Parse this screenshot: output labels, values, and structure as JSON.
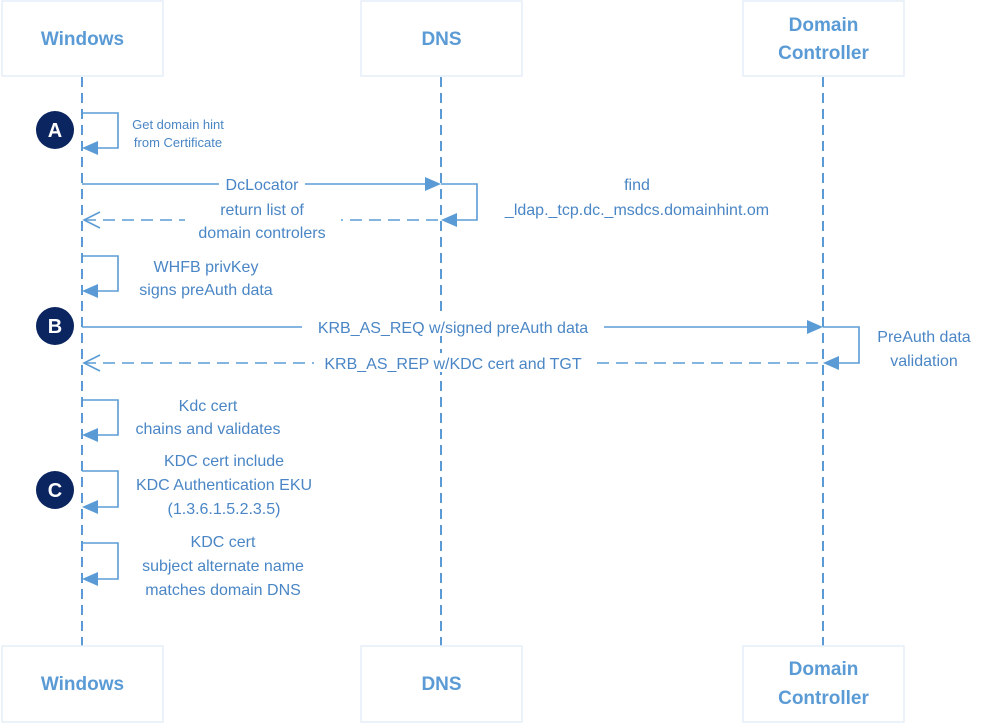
{
  "actors": [
    {
      "id": "windows",
      "label_lines": [
        "Windows"
      ]
    },
    {
      "id": "dns",
      "label_lines": [
        "DNS"
      ]
    },
    {
      "id": "dc",
      "label_lines": [
        "Domain",
        "Controller"
      ]
    }
  ],
  "badges": [
    "A",
    "B",
    "C"
  ],
  "messages": {
    "get_domain_hint": {
      "from": "windows",
      "to": "windows",
      "type": "self",
      "lines": [
        "Get domain hint",
        "from Certificate"
      ]
    },
    "dclocator": {
      "from": "windows",
      "to": "dns",
      "type": "solid",
      "lines": [
        "DcLocator"
      ]
    },
    "find_ldap": {
      "from": "dns",
      "to": "dns",
      "type": "self",
      "lines": [
        "find",
        "_ldap._tcp.dc._msdcs.domainhint.om"
      ]
    },
    "return_list": {
      "from": "dns",
      "to": "windows",
      "type": "dashed",
      "lines": [
        "return list of",
        "domain controlers"
      ]
    },
    "whfb_sign": {
      "from": "windows",
      "to": "windows",
      "type": "self",
      "lines": [
        "WHFB privKey",
        "signs preAuth data"
      ]
    },
    "krb_as_req": {
      "from": "windows",
      "to": "dc",
      "type": "solid",
      "lines": [
        "KRB_AS_REQ w/signed preAuth data"
      ]
    },
    "preauth_validation": {
      "from": "dc",
      "to": "dc",
      "type": "self",
      "lines": [
        "PreAuth data",
        "validation"
      ]
    },
    "krb_as_rep": {
      "from": "dc",
      "to": "windows",
      "type": "dashed",
      "lines": [
        "KRB_AS_REP w/KDC cert and TGT"
      ]
    },
    "kdc_chain": {
      "from": "windows",
      "to": "windows",
      "type": "self",
      "lines": [
        "Kdc cert",
        "chains and validates"
      ]
    },
    "kdc_eku": {
      "from": "windows",
      "to": "windows",
      "type": "self",
      "lines": [
        "KDC cert include",
        "KDC Authentication EKU",
        "(1.3.6.1.5.2.3.5)"
      ]
    },
    "kdc_san": {
      "from": "windows",
      "to": "windows",
      "type": "self",
      "lines": [
        "KDC cert",
        "subject alternate name",
        "matches domain DNS"
      ]
    }
  },
  "colors": {
    "line": "#5b9bd5",
    "text": "#4a86c5",
    "badge": "#0b2560",
    "actor_border": "#e6eef7"
  }
}
